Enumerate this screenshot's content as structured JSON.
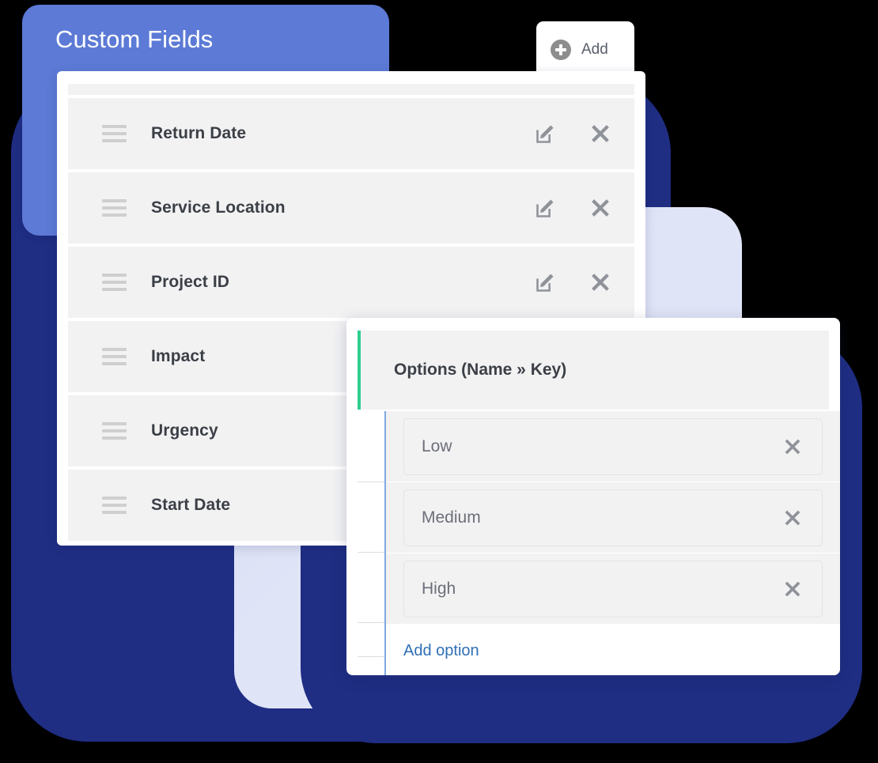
{
  "header": {
    "title": "Custom Fields",
    "accent_color": "#5c7ad6"
  },
  "add_tab": {
    "label": "Add",
    "icon": "plus-circle-icon"
  },
  "fields_panel": {
    "rows": [
      {
        "name": "Return Date",
        "drag_icon": "drag-handle-icon",
        "edit_icon": "edit-pencil-icon",
        "delete_icon": "close-x-icon"
      },
      {
        "name": "Service Location",
        "drag_icon": "drag-handle-icon",
        "edit_icon": "edit-pencil-icon",
        "delete_icon": "close-x-icon"
      },
      {
        "name": "Project ID",
        "drag_icon": "drag-handle-icon",
        "edit_icon": "edit-pencil-icon",
        "delete_icon": "close-x-icon"
      },
      {
        "name": "Impact",
        "drag_icon": "drag-handle-icon",
        "edit_icon": "edit-pencil-icon",
        "delete_icon": "close-x-icon"
      },
      {
        "name": "Urgency",
        "drag_icon": "drag-handle-icon",
        "edit_icon": "edit-pencil-icon",
        "delete_icon": "close-x-icon"
      },
      {
        "name": "Start Date",
        "drag_icon": "drag-handle-icon",
        "edit_icon": "edit-pencil-icon",
        "delete_icon": "close-x-icon"
      }
    ]
  },
  "options_panel": {
    "title": "Options (Name » Key)",
    "accent_color": "#2ecf8e",
    "rail_color": "#7fa8e3",
    "options": [
      {
        "value": "Low",
        "delete_icon": "close-x-icon"
      },
      {
        "value": "Medium",
        "delete_icon": "close-x-icon"
      },
      {
        "value": "High",
        "delete_icon": "close-x-icon"
      }
    ],
    "add_option_label": "Add option",
    "link_color": "#2f6fb5"
  },
  "background": {
    "navy": "#1f2d83",
    "lavender": "#dce0f5"
  }
}
